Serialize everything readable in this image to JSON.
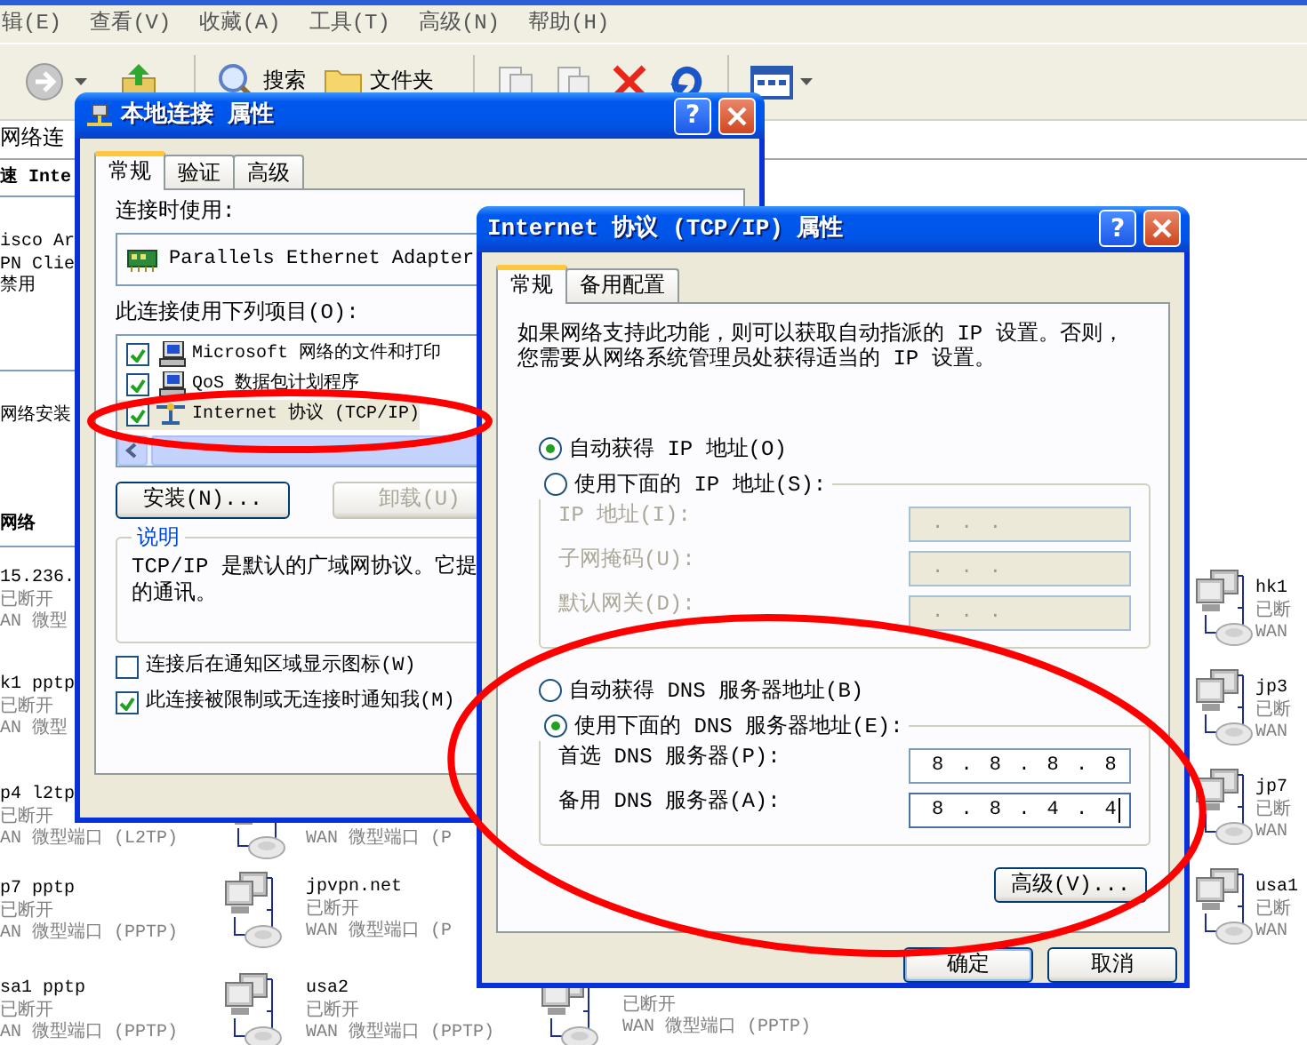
{
  "explorer": {
    "menu": [
      "辑(E)",
      "查看(V)",
      "收藏(A)",
      "工具(T)",
      "高级(N)",
      "帮助(H)"
    ],
    "toolbar": [
      {
        "kind": "forward"
      },
      {
        "kind": "up"
      },
      {
        "kind": "search",
        "label": "搜索"
      },
      {
        "kind": "folders",
        "label": "文件夹"
      },
      {
        "kind": "copy"
      },
      {
        "kind": "move"
      },
      {
        "kind": "delete"
      },
      {
        "kind": "undo"
      },
      {
        "kind": "views"
      }
    ],
    "address": "网络连",
    "items": [
      {
        "kind": "heading",
        "text": "速 Inte"
      },
      {
        "kind": "text",
        "lines": [
          "isco Ar",
          "PN Clie",
          "禁用"
        ]
      },
      {
        "kind": "text",
        "lines": [
          "网络安装"
        ]
      },
      {
        "kind": "heading",
        "text": "网络"
      },
      {
        "kind": "connection",
        "name": "15.236.",
        "status": "已断开",
        "device": "AN 微型"
      },
      {
        "kind": "connection",
        "name": "k1 pptp",
        "status": "已断开",
        "device": "AN 微型"
      },
      {
        "kind": "connection",
        "name": "p4 l2tp",
        "status": "已断开",
        "device": "AN 微型端口 (L2TP)"
      },
      {
        "kind": "connection",
        "name": "p7 pptp",
        "status": "已断开",
        "device": "AN 微型端口 (PPTP)"
      },
      {
        "kind": "connection",
        "name": "sa1 pptp",
        "status": "已断开",
        "device": "AN 微型端口 (PPTP)"
      },
      {
        "kind": "connection",
        "device": "WAN 微型端口 (P"
      },
      {
        "kind": "connection",
        "name": "jpvpn.net",
        "status": "已断开",
        "device": "WAN 微型端口 (P"
      },
      {
        "kind": "connection",
        "name": "usa2",
        "status": "已断开",
        "device": "WAN 微型端口 (PPTP)"
      },
      {
        "kind": "connection",
        "status": "已断开",
        "device": "WAN 微型端口 (PPTP)"
      },
      {
        "kind": "connection",
        "name": "hk1",
        "status": "已断",
        "device": "WAN"
      },
      {
        "kind": "connection",
        "name": "jp3",
        "status": "已断",
        "device": "WAN"
      },
      {
        "kind": "connection",
        "name": "jp7",
        "status": "已断",
        "device": "WAN"
      },
      {
        "kind": "connection",
        "name": "usa1",
        "status": "已断",
        "device": "WAN"
      }
    ]
  },
  "local_dialog": {
    "title": "本地连接 属性",
    "help": "?",
    "tabs": [
      {
        "label": "常规",
        "selected": true
      },
      {
        "label": "验证",
        "selected": false
      },
      {
        "label": "高级",
        "selected": false
      }
    ],
    "connect_using_label": "连接时使用:",
    "adapter": "Parallels Ethernet Adapter",
    "components_label": "此连接使用下列项目(O):",
    "components": [
      {
        "label": "Microsoft 网络的文件和打印",
        "checked": true,
        "selected": false
      },
      {
        "label": "QoS 数据包计划程序",
        "checked": true,
        "selected": false
      },
      {
        "label": "Internet 协议 (TCP/IP)",
        "checked": true,
        "selected": true
      }
    ],
    "buttons": [
      {
        "label": "安装(N)...",
        "disabled": false
      },
      {
        "label": "卸载(U)",
        "disabled": true
      }
    ],
    "description": {
      "legend": "说明",
      "lines": [
        "TCP/IP 是默认的广域网协议。它提",
        "的通讯。"
      ]
    },
    "options": [
      {
        "label": "连接后在通知区域显示图标(W)",
        "checked": false
      },
      {
        "label": "此连接被限制或无连接时通知我(M)",
        "checked": true
      }
    ]
  },
  "tcpip_dialog": {
    "title": "Internet 协议 (TCP/IP) 属性",
    "help": "?",
    "tabs": [
      {
        "label": "常规",
        "selected": true
      },
      {
        "label": "备用配置",
        "selected": false
      }
    ],
    "intro": [
      "如果网络支持此功能，则可以获取自动指派的 IP 设置。否则，",
      "您需要从网络系统管理员处获得适当的 IP 设置。"
    ],
    "ip_modes": [
      {
        "label": "自动获得 IP 地址(O)",
        "selected": true
      },
      {
        "label": "使用下面的 IP 地址(S):",
        "selected": false
      }
    ],
    "ip_fields": [
      {
        "label": "IP 地址(I):",
        "value": ". . .",
        "disabled": true,
        "focused": false
      },
      {
        "label": "子网掩码(U):",
        "value": ". . .",
        "disabled": true,
        "focused": false
      },
      {
        "label": "默认网关(D):",
        "value": ". . .",
        "disabled": true,
        "focused": false
      }
    ],
    "dns_modes": [
      {
        "label": "自动获得 DNS 服务器地址(B)",
        "selected": false
      },
      {
        "label": "使用下面的 DNS 服务器地址(E):",
        "selected": true
      }
    ],
    "dns_fields": [
      {
        "label": "首选 DNS 服务器(P):",
        "value": "8 . 8 . 8 . 8",
        "disabled": false,
        "focused": false
      },
      {
        "label": "备用 DNS 服务器(A):",
        "value": "8 . 8 . 4 . 4",
        "disabled": false,
        "focused": true
      }
    ],
    "advanced_button": "高级(V)...",
    "ok_button": "确定",
    "cancel_button": "取消"
  },
  "highlights": [
    {
      "kind": "ellipse"
    },
    {
      "kind": "ellipse"
    }
  ]
}
